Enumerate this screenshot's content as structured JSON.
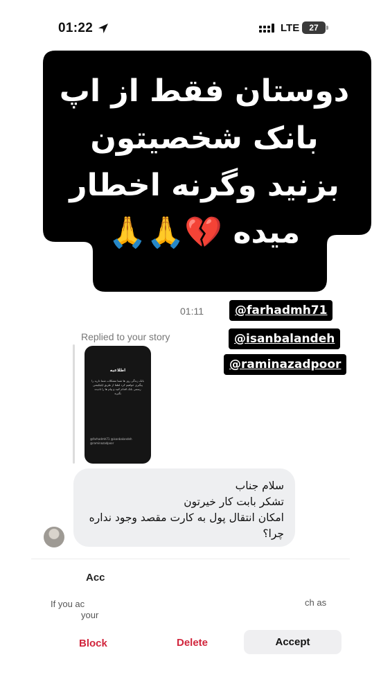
{
  "status_bar": {
    "time": "01:22",
    "carrier": "LTE",
    "battery": "27",
    "icons": [
      "location-arrow-icon",
      "signal-icon",
      "battery-icon"
    ]
  },
  "overlay": {
    "lines": [
      "دوستان فقط از اپ",
      "بانک شخصیتون",
      "بزنید وگرنه اخطار",
      "میده 💔🙏🙏"
    ]
  },
  "mentions": [
    "@farhadmh71",
    "@isanbalandeh",
    "@raminazadpoor"
  ],
  "chat": {
    "timestamp": "01:11",
    "replied_label": "Replied to your story",
    "story": {
      "title": "اطلاعیه",
      "body": "بانک زندگی روز ها شما مشکلات شما دارید را پیگیری خواهیم کرد لطفا از طریق اپلیکیشن رسمی بانک اقدام کنید و پیام ها را نادیده بگیرید",
      "tags": "@farhadmh71 @isanbalandeh @raminazadpoor"
    },
    "message_lines": [
      "سلام جناب",
      "تشکر بابت کار خیرتون",
      "امکان انتقال پول به کارت مقصد وجود نداره",
      "چرا؟"
    ]
  },
  "request_panel": {
    "heading": "Acc",
    "info_line1": "If you ac",
    "info_line2": "your",
    "info_tail": "ch as",
    "buttons": {
      "block": "Block",
      "delete": "Delete",
      "accept": "Accept"
    }
  },
  "colors": {
    "overlay_bg": "#000000",
    "danger": "#d1253c",
    "bubble_bg": "#eeeff1"
  }
}
